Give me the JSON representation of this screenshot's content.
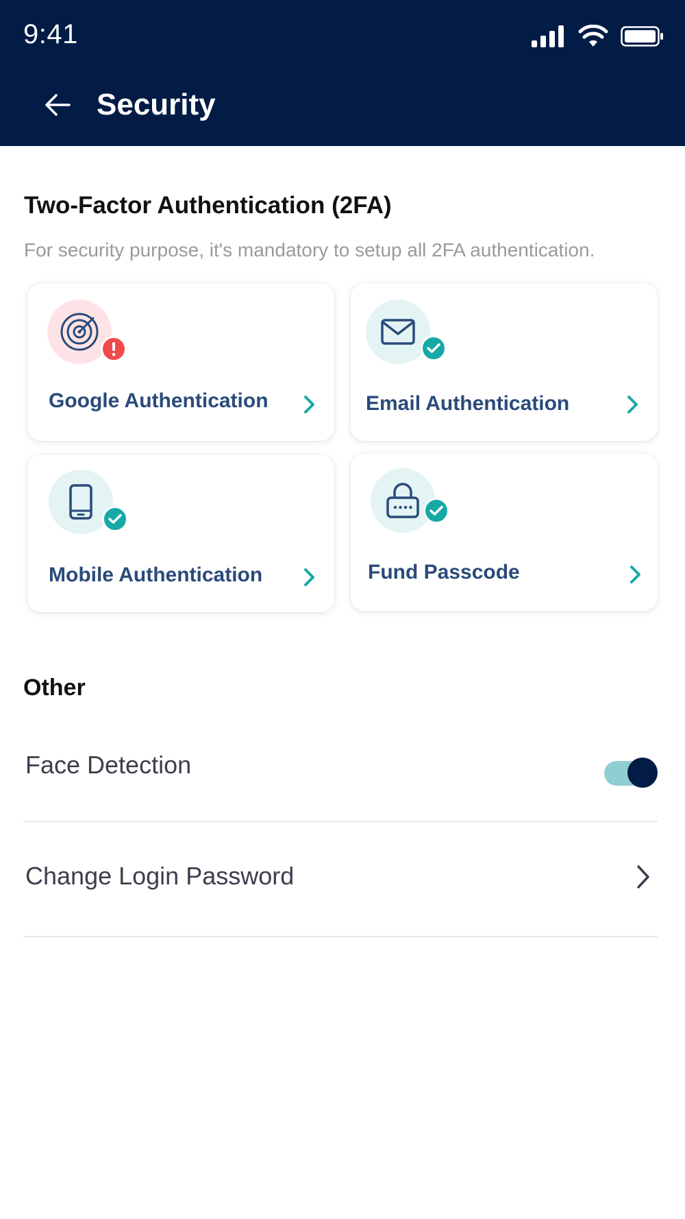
{
  "status_bar": {
    "time": "9:41"
  },
  "header": {
    "title": "Security"
  },
  "two_factor": {
    "title": "Two-Factor Authentication (2FA)",
    "description": "For security purpose, it's mandatory to setup all 2FA authentication.",
    "cards": [
      {
        "label": "Google Authentication",
        "icon": "target-icon",
        "status": "warning"
      },
      {
        "label": "Email Authentication",
        "icon": "mail-icon",
        "status": "verified"
      },
      {
        "label": "Mobile Authentication",
        "icon": "phone-icon",
        "status": "verified"
      },
      {
        "label": "Fund Passcode",
        "icon": "lock-icon",
        "status": "verified"
      }
    ]
  },
  "other": {
    "title": "Other",
    "face_detection": {
      "label": "Face Detection",
      "enabled": true
    },
    "change_password": {
      "label": "Change Login Password"
    }
  },
  "colors": {
    "header_bg": "#031c45",
    "teal": "#17a9a6",
    "warning": "#f04b4b",
    "card_label": "#2a4a7a"
  }
}
